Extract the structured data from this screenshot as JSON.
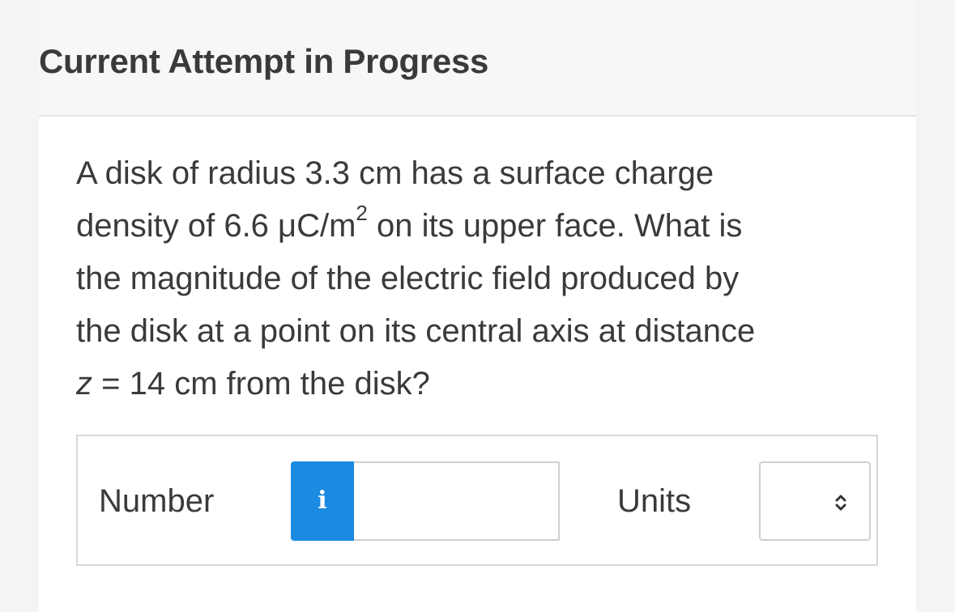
{
  "header": {
    "title": "Current Attempt in Progress"
  },
  "question": {
    "line1": "A disk of radius 3.3 cm has a surface charge",
    "line2_before_sup": "density of 6.6 μC/m",
    "line2_sup": "2",
    "line2_after_sup": " on its upper face. What is",
    "line3": "the magnitude of the electric field produced by",
    "line4": "the disk at a point on its central axis at distance",
    "line5_var": "z",
    "line5_rest": " = 14 cm from the disk?"
  },
  "answer": {
    "number_label": "Number",
    "info_icon": "i",
    "number_value": "",
    "units_label": "Units",
    "units_selected": ""
  },
  "colors": {
    "info_button": "#1a8be0",
    "header_bg": "#f7f7f7",
    "text": "#3a3a3a"
  },
  "icons": {
    "info": "info-icon",
    "units_dropdown": "chevron-up-down-icon"
  }
}
